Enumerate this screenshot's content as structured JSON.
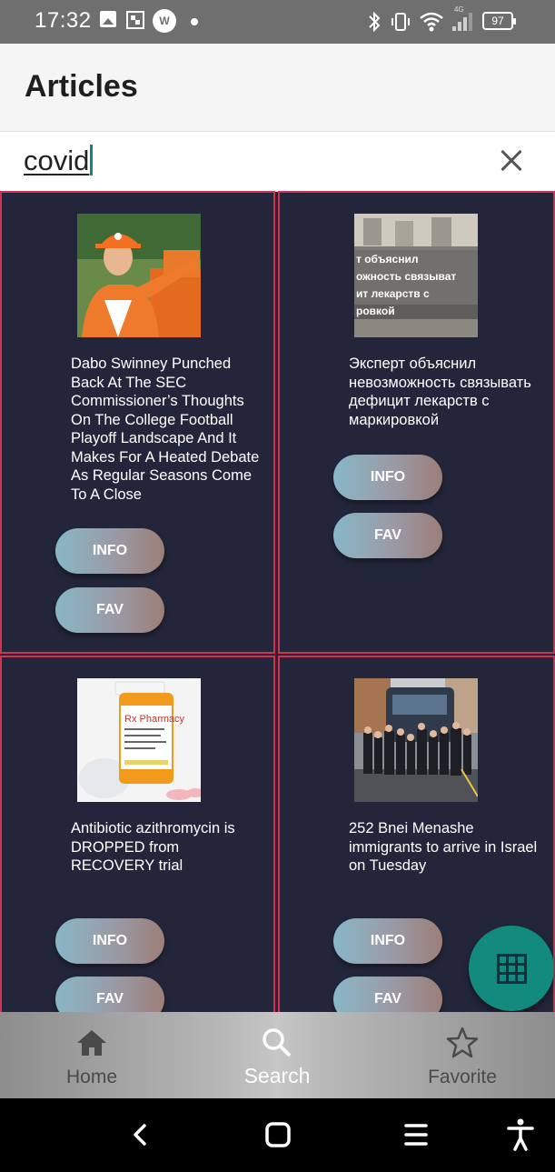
{
  "status_bar": {
    "time": "17:32",
    "battery": "97",
    "network_label": "4G",
    "icons": [
      "gallery-icon",
      "qr-icon",
      "ww-app-icon",
      "dot-icon",
      "bluetooth-icon",
      "vibrate-icon",
      "wifi-icon",
      "signal-icon",
      "battery-icon"
    ]
  },
  "app_bar": {
    "title": "Articles"
  },
  "search": {
    "value": "covid",
    "clear_icon": "close-icon"
  },
  "articles": [
    {
      "title": "Dabo Swinney Punched Back At The SEC Commissioner’s Thoughts On The College Football Playoff Landscape And It Makes For A Heated Debate As Regular Seasons Come To A Close",
      "info_label": "INFO",
      "fav_label": "FAV"
    },
    {
      "title": "Эксперт объяснил невозможность связывать дефицит лекарств с маркировкой",
      "image_text": "т объяснил\nожность связыват\nит лекарств с\nровкой",
      "info_label": "INFO",
      "fav_label": "FAV"
    },
    {
      "title": "Antibiotic azithromycin is DROPPED from RECOVERY trial",
      "image_text": "Rx Pharmacy",
      "info_label": "INFO",
      "fav_label": "FAV"
    },
    {
      "title": "252 Bnei Menashe immigrants to arrive in Israel on Tuesday",
      "info_label": "INFO",
      "fav_label": "FAV"
    }
  ],
  "fab": {
    "icon": "grid-icon"
  },
  "bottom_nav": [
    {
      "label": "Home",
      "icon": "home-icon",
      "active": false
    },
    {
      "label": "Search",
      "icon": "search-icon",
      "active": true
    },
    {
      "label": "Favorite",
      "icon": "star-icon",
      "active": false
    }
  ],
  "system_nav": [
    "back-icon",
    "home-square-icon",
    "recents-icon",
    "accessibility-icon"
  ],
  "colors": {
    "background": "#23263a",
    "card_border": "#d1334f",
    "fab": "#128a7d",
    "cursor": "#16857a"
  }
}
